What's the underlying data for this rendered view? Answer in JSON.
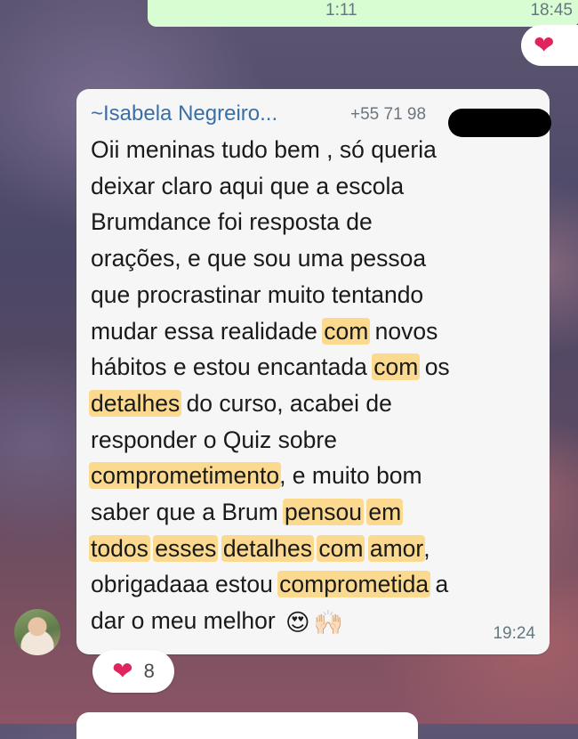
{
  "previous_message": {
    "duration": "1:11",
    "time": "18:45",
    "reaction_icon": "red-heart"
  },
  "message": {
    "sender_name": "~Isabela Negreiro...",
    "sender_phone": "+55 71 98",
    "text_lines": [
      [
        {
          "t": "Oii meninas tudo bem , só queria"
        }
      ],
      [
        {
          "t": "deixar claro aqui que a escola"
        }
      ],
      [
        {
          "t": "Brumdance foi resposta de"
        }
      ],
      [
        {
          "t": "orações, e que sou uma pessoa"
        }
      ],
      [
        {
          "t": "que procrastinar muito tentando"
        }
      ],
      [
        {
          "t": "mudar essa realidade "
        },
        {
          "t": "com",
          "h": true
        },
        {
          "t": " novos"
        }
      ],
      [
        {
          "t": "hábitos e estou encantada "
        },
        {
          "t": "com",
          "h": true
        },
        {
          "t": " os"
        }
      ],
      [
        {
          "t": "detalhes",
          "h": true
        },
        {
          "t": " do curso, acabei de"
        }
      ],
      [
        {
          "t": "responder o Quiz sobre"
        }
      ],
      [
        {
          "t": "comprometimento",
          "h": true
        },
        {
          "t": ", e muito bom"
        }
      ],
      [
        {
          "t": "saber que a Brum "
        },
        {
          "t": "pensou",
          "h": true
        },
        {
          "t": " "
        },
        {
          "t": "em",
          "h": true
        }
      ],
      [
        {
          "t": "todos",
          "h": true
        },
        {
          "t": " "
        },
        {
          "t": "esses",
          "h": true
        },
        {
          "t": " "
        },
        {
          "t": "detalhes",
          "h": true
        },
        {
          "t": " "
        },
        {
          "t": "com",
          "h": true
        },
        {
          "t": " "
        },
        {
          "t": "amor",
          "h": true
        },
        {
          "t": ","
        }
      ],
      [
        {
          "t": "obrigadaaa estou "
        },
        {
          "t": "comprometida",
          "h": true
        },
        {
          "t": " a"
        }
      ],
      [
        {
          "t": "dar o meu melhor "
        }
      ]
    ],
    "emojis": [
      "😍",
      "🙌🏻"
    ],
    "time": "19:24",
    "highlight_color": "#fbd98e"
  },
  "reaction": {
    "icon": "red-heart",
    "count": "8"
  }
}
